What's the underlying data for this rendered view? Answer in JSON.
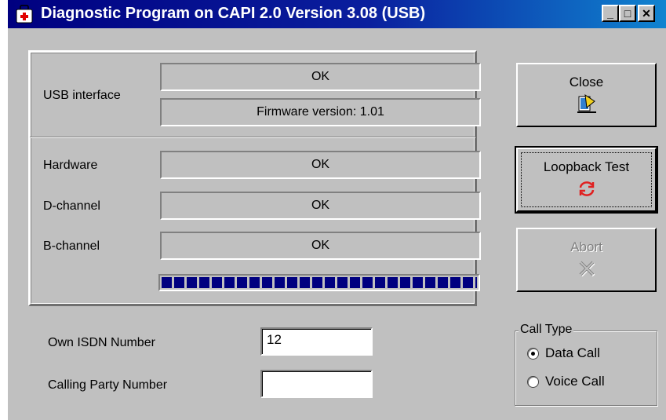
{
  "window": {
    "title": "Diagnostic Program on CAPI 2.0 Version 3.08 (USB)",
    "minimize_glyph": "_",
    "maximize_glyph": "□",
    "close_glyph": "✕"
  },
  "usb": {
    "label": "USB interface",
    "status": "OK",
    "firmware": "Firmware version: 1.01"
  },
  "tests": [
    {
      "label": "Hardware",
      "status": "OK"
    },
    {
      "label": "D-channel",
      "status": "OK"
    },
    {
      "label": "B-channel",
      "status": "OK"
    }
  ],
  "progress": {
    "fraction": 1.0,
    "color": "#000080"
  },
  "buttons": {
    "close": {
      "label": "Close",
      "icon": "door-exit-icon"
    },
    "loopback": {
      "label": "Loopback Test",
      "icon": "loop-arrows-icon"
    },
    "abort": {
      "label": "Abort",
      "icon": "cancel-x-icon"
    }
  },
  "fields": {
    "own_isdn_label": "Own ISDN Number",
    "own_isdn_value": "12",
    "calling_party_label": "Calling Party Number",
    "calling_party_value": ""
  },
  "call_type": {
    "legend": "Call Type",
    "options": [
      {
        "label": "Data Call",
        "selected": true
      },
      {
        "label": "Voice Call",
        "selected": false
      }
    ]
  },
  "colors": {
    "title_bar": "#000080",
    "face": "#c0c0c0",
    "loop_icon": "#e02020"
  }
}
